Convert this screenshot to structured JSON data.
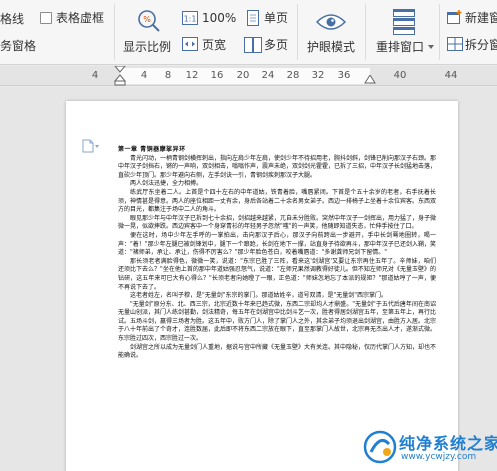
{
  "ribbon": {
    "left_cut_1": "格线",
    "left_cut_2": "务窗格",
    "table_gridlines_label": "表格虚框",
    "display_ratio_label": "显示比例",
    "zoom_100_label": "100%",
    "page_width_label": "页宽",
    "single_page_label": "单页",
    "multi_page_label": "多页",
    "eye_protection_label": "护眼模式",
    "rearrange_window_label": "重排窗口",
    "new_window_label": "新建窗",
    "split_window_label": "拆分窗"
  },
  "ruler": {
    "ticks": [
      "4",
      "4",
      "8",
      "12",
      "16",
      "20",
      "24",
      "28",
      "32",
      "36",
      "40",
      "44"
    ]
  },
  "document": {
    "title": "第一章  青铜器摩挲异环",
    "paragraphs": [
      "青光闪动，一柄青钢剑横挥刺出，指向左肩少年左肩，使剑少年不待招用老，腕抖剑斜，剑锋已削向那汉子右颈。那中年汉子剑挡右，锵的一声响，双剑相击，嗡嗡作声，震声未绝，双剑剑光霍霍，已拆了三招，中年汉子长剑猛地击落，直砍少年顶门。那少年避向右侧，左手剑诀一引，青钢剑疾刺那汉子大腿。",
      "两人剑法迅捷，全力相搏。",
      "练武厅东坐着二人。上首是个四十左右的中年道姑，铁青着脸，嘴唇紧闭。下首是个五十余岁的老者，右手抚着长须，神情甚是得意。两人的座位相距一丈有余，身后各站着二十余名男女弟子。西边一排椅子上坐着十余位宾客。东西双方的目光，都集注于场中二人的角斗。",
      "眼见那少年与中年汉子已拆到七十余招，剑招越来越紧，兀自未分胜败。突然中年汉子一剑挥出，用力猛了，身子微微一晃，似欲摔跌。西边宾客中一个身穿青衫的年轻男子忽然\"嗤\"的一声笑，他随即知道失态，忙伸手按住了口。",
      "便在这时，场中少年左手呼的一掌拍出，击向那汉子后心，那汉子向前跨出一步避开，手中长剑蓦地圈转，喝一声：\"着！\"那少年左腿已被剑锋划中，腿下一个踉跄，长剑在地下一撑，站直身子待欲再斗，那中年汉子已还剑入鞘，笑道：\"褚师弟，承让、承让，伤得不厉害么？\"那少年脸色苍白，咬着嘴唇道：\"多谢龚师兄剑下留情。\"",
      "那长须老者满脸得色，微微一笑，说道：\"东宗已胜了三阵，看来这'剑湖宫'又要让东宗再住五年了。辛师妹，咱们还须比下去么？\"坐在他上首的那中年道姑强忍怒气，说道：\"左师兄果然调教得好徒儿。但不知左师兄对《无量玉壁》的钻研，这五年来可已大有心得么？\"长须老者向她瞪了一眼，正色道：\"师妹怎地忘了本派的规矩？\"那道姑哼了一声，便不再说下去了。",
      "这老者姓左，名叫子穆，是\"无量剑\"东宗的掌门。那道姑姓辛，道号双清，是\"无量剑\"西宗掌门。",
      "\"无量剑\"原分东、北、西三宗，北宗近数十年来已趋式微，东西二宗却均人才鼎盛。\"无量剑\"于五代后唐年间在南诏无量山创派，其门人练剑甚勤，剑法精奇，每五年在剑湖宫中比剑斗艺一次，胜者得居剑湖宫五年，至第五年上，再行比试。五场斗剑，赢得三场者为胜。这五年中，败方门人，除了掌门人之外，其余弟子均须退出剑湖宫，由胜方入居。北宗于八十年前出了个奇才，连胜数届，此后即不将东西二宗放在眼下，直至那掌门人故世，北宗再无杰出人才，遂渐式微。东宗胜过四次，西宗胜过一次。",
      "剑湖宫之所以成为无量剑门人重地，据说与宫中所藏《无量玉壁》大有关连。其中隐秘，仅历代掌门人方知，却也不能确说。"
    ]
  },
  "watermark": {
    "brand": "纯净系统之家",
    "url": "www.ycwjzy.com"
  }
}
